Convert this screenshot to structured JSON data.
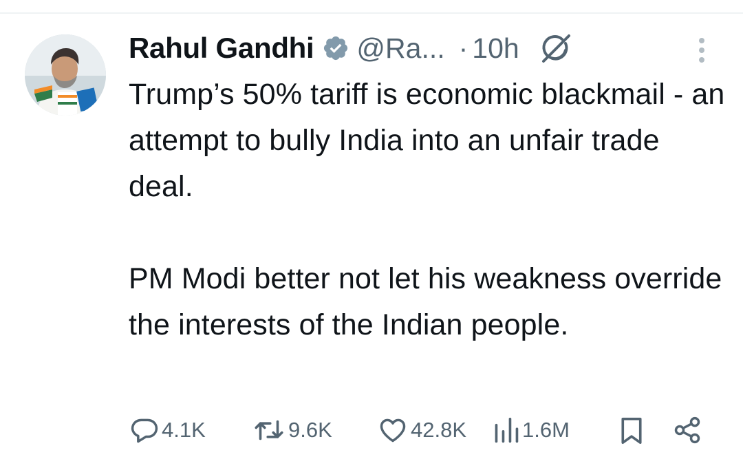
{
  "tweet": {
    "author_name": "Rahul Gandhi",
    "handle": "@Ra...",
    "separator": "·",
    "time": "10h",
    "paragraphs": [
      "Trump’s 50% tariff is economic blackmail - an attempt to bully India into an unfair trade deal.",
      "PM Modi better not let his weakness override the interests of the Indian people."
    ],
    "icons": [
      "verified-badge-icon",
      "grok-icon",
      "more-options-icon",
      "reply-icon",
      "repost-icon",
      "like-icon",
      "views-icon",
      "bookmark-icon",
      "share-icon"
    ]
  },
  "actions": {
    "replies": "4.1K",
    "reposts": "9.6K",
    "likes": "42.8K",
    "views": "1.6M"
  },
  "colors": {
    "text": "#0f1419",
    "secondary": "#536471",
    "verified_badge": "#829aab",
    "divider": "#eff3f4"
  }
}
